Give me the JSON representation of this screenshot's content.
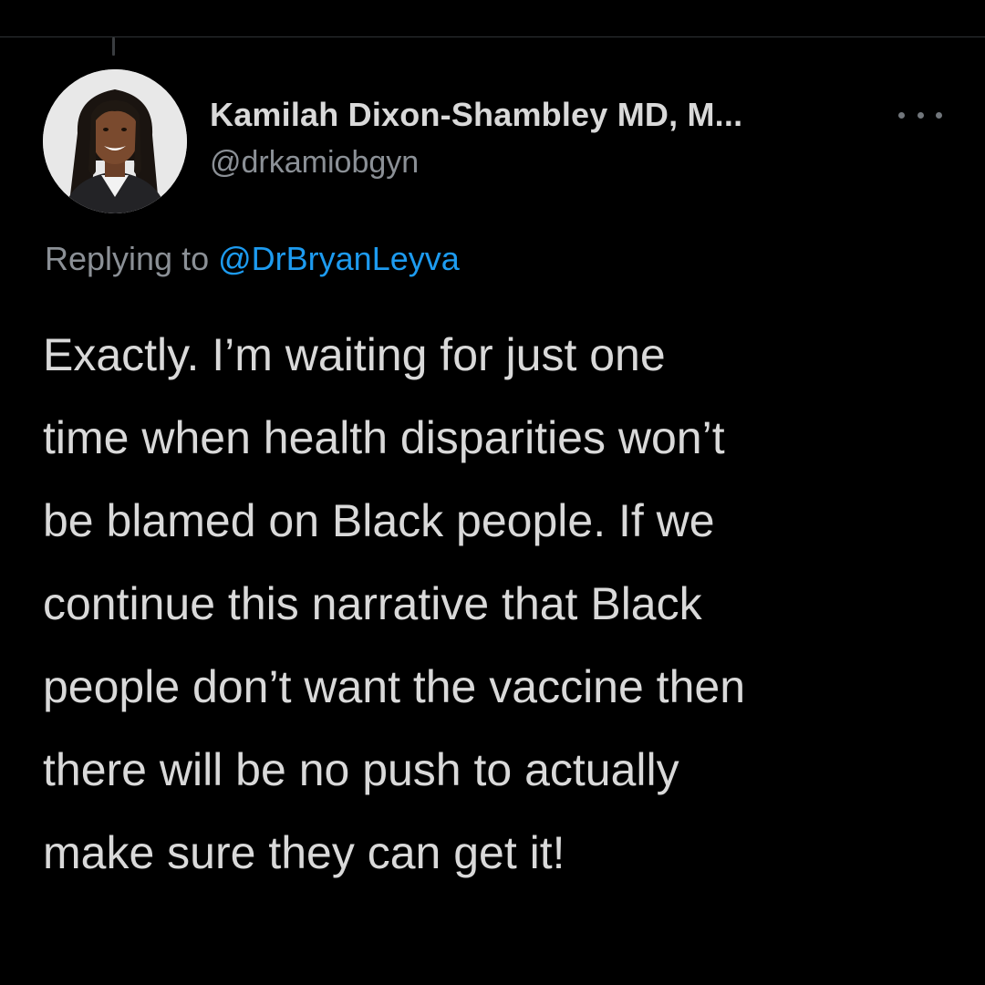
{
  "tweet": {
    "author": {
      "display_name": "Kamilah Dixon-Shambley MD, M...",
      "handle": "@drkamiobgyn",
      "avatar_icon": "profile-photo"
    },
    "more_icon": "more-options-icon",
    "reply_context": {
      "prefix": "Replying to",
      "mention": "@DrBryanLeyva"
    },
    "text_lines": [
      "Exactly.  I’m waiting for just one",
      "time when health disparities won’t",
      "be blamed on Black people.  If we",
      "continue this narrative that Black",
      "people don’t want the vaccine then",
      "there will be no push to actually",
      "make sure they can get it!"
    ]
  },
  "colors": {
    "background": "#000000",
    "text": "#d9d9d9",
    "secondary_text": "#8b9096",
    "link": "#1d9bf0"
  }
}
